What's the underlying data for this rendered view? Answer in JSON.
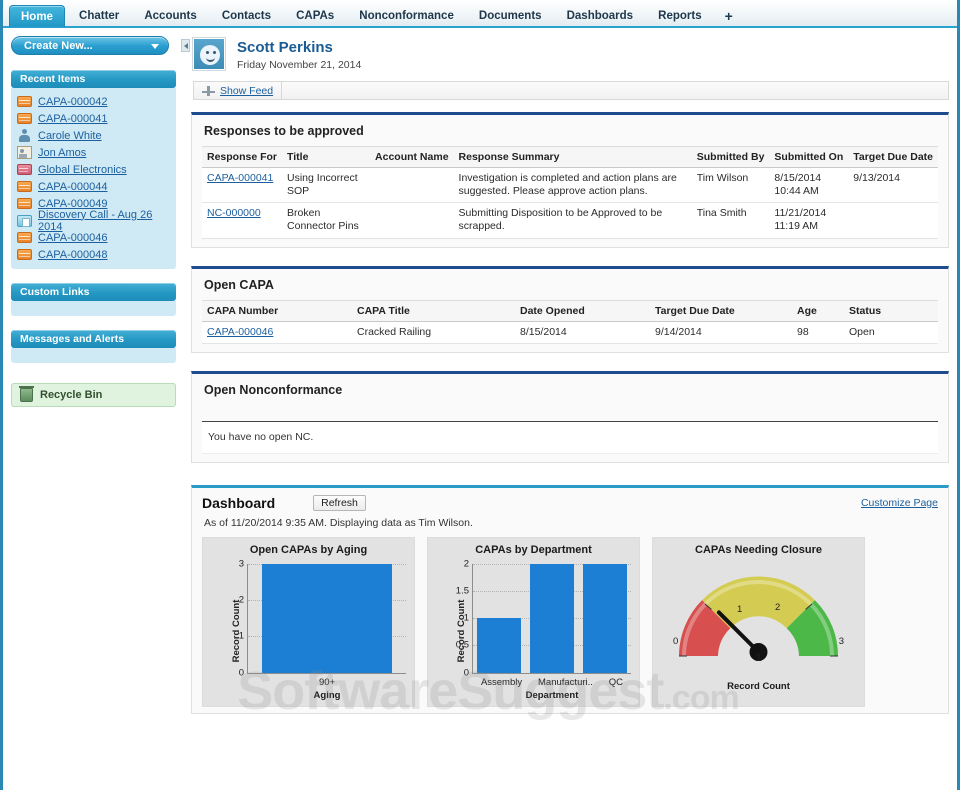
{
  "tabs": [
    {
      "label": "Home",
      "active": true
    },
    {
      "label": "Chatter",
      "active": false
    },
    {
      "label": "Accounts",
      "active": false
    },
    {
      "label": "Contacts",
      "active": false
    },
    {
      "label": "CAPAs",
      "active": false
    },
    {
      "label": "Nonconformance",
      "active": false
    },
    {
      "label": "Documents",
      "active": false
    },
    {
      "label": "Dashboards",
      "active": false
    },
    {
      "label": "Reports",
      "active": false
    },
    {
      "label": "+",
      "active": false
    }
  ],
  "sidebar": {
    "create_new_label": "Create New...",
    "recent_items": {
      "header": "Recent Items",
      "items": [
        {
          "label": "CAPA-000042",
          "icon": "capa-record-icon"
        },
        {
          "label": "CAPA-000041",
          "icon": "capa-record-icon"
        },
        {
          "label": "Carole White",
          "icon": "user-icon"
        },
        {
          "label": "Jon Amos",
          "icon": "contact-icon"
        },
        {
          "label": "Global Electronics",
          "icon": "account-icon"
        },
        {
          "label": "CAPA-000044",
          "icon": "capa-record-icon"
        },
        {
          "label": "CAPA-000049",
          "icon": "capa-record-icon"
        },
        {
          "label": "Discovery Call - Aug 26 2014",
          "icon": "event-icon"
        },
        {
          "label": "CAPA-000046",
          "icon": "capa-record-icon"
        },
        {
          "label": "CAPA-000048",
          "icon": "capa-record-icon"
        }
      ]
    },
    "custom_links": {
      "header": "Custom Links"
    },
    "messages_and_alerts": {
      "header": "Messages and Alerts"
    },
    "recycle_bin": {
      "label": "Recycle Bin"
    }
  },
  "user": {
    "name": "Scott Perkins",
    "date": "Friday November 21, 2014",
    "show_feed_label": "Show Feed"
  },
  "responses_panel": {
    "title": "Responses to be approved",
    "columns": [
      "Response For",
      "Title",
      "Account Name",
      "Response Summary",
      "Submitted By",
      "Submitted On",
      "Target Due Date"
    ],
    "rows": [
      {
        "response_for": "CAPA-000041",
        "title": "Using Incorrect SOP",
        "account_name": "",
        "summary": "Investigation is completed and action plans are suggested. Please approve action plans.",
        "submitted_by": "Tim Wilson",
        "submitted_on": "8/15/2014 10:44 AM",
        "target_due_date": "9/13/2014"
      },
      {
        "response_for": "NC-000000",
        "title": "Broken Connector Pins",
        "account_name": "",
        "summary": "Submitting Disposition to be Approved to be scrapped.",
        "submitted_by": "Tina Smith",
        "submitted_on": "11/21/2014 11:19 AM",
        "target_due_date": ""
      }
    ]
  },
  "open_capa_panel": {
    "title": "Open CAPA",
    "columns": [
      "CAPA Number",
      "CAPA Title",
      "Date Opened",
      "Target Due Date",
      "Age",
      "Status"
    ],
    "rows": [
      {
        "capa_number": "CAPA-000046",
        "capa_title": "Cracked Railing",
        "date_opened": "8/15/2014",
        "target_due_date": "9/14/2014",
        "age": "98",
        "status": "Open"
      }
    ]
  },
  "open_nc_panel": {
    "title": "Open Nonconformance",
    "empty_message": "You have no open NC."
  },
  "dashboard": {
    "title": "Dashboard",
    "refresh_label": "Refresh",
    "customize_label": "Customize Page",
    "subtitle": "As of 11/20/2014 9:35 AM. Displaying data as Tim Wilson."
  },
  "watermark": {
    "text": "SoftwareSuggest",
    "suffix": ".com"
  },
  "colors": {
    "tab_active": "#2197c6",
    "panel_accent": "#1f4c8f",
    "dashboard_accent": "#2a9ac6",
    "bar_blue": "#1c7fd4",
    "gauge_red": "#d7504f",
    "gauge_yellow": "#d4cc52",
    "gauge_green": "#4cb848",
    "link": "#1c5f9e",
    "sidebar_body": "#cfeaf5"
  },
  "chart_data": [
    {
      "type": "bar",
      "title": "Open CAPAs by Aging",
      "categories": [
        "90+"
      ],
      "values": [
        3
      ],
      "xlabel": "Aging",
      "ylabel": "Record Count",
      "yticks": [
        0,
        1,
        2,
        3
      ],
      "ylim": [
        0,
        3
      ],
      "grid": true,
      "legend": "none"
    },
    {
      "type": "bar",
      "title": "CAPAs by Department",
      "categories": [
        "Assembly",
        "Manufacturi..",
        "QC"
      ],
      "values": [
        1,
        2,
        2
      ],
      "xlabel": "Department",
      "ylabel": "Record Count",
      "yticks": [
        0,
        0.5,
        1,
        1.5,
        2
      ],
      "ylim": [
        0,
        2
      ],
      "grid": true,
      "legend": "none"
    },
    {
      "type": "gauge",
      "title": "CAPAs Needing Closure",
      "value": 1,
      "value_label": "1",
      "min": 0,
      "max": 3,
      "min_label": "0",
      "max_label": "3",
      "breakpoint_labels": [
        "1",
        "2"
      ],
      "segments": [
        {
          "from": 0,
          "to": 1,
          "color": "#d7504f"
        },
        {
          "from": 1,
          "to": 2,
          "color": "#d4cc52"
        },
        {
          "from": 2,
          "to": 3,
          "color": "#4cb848"
        }
      ],
      "caption": "Record Count",
      "ylabel": "Record Count"
    }
  ]
}
